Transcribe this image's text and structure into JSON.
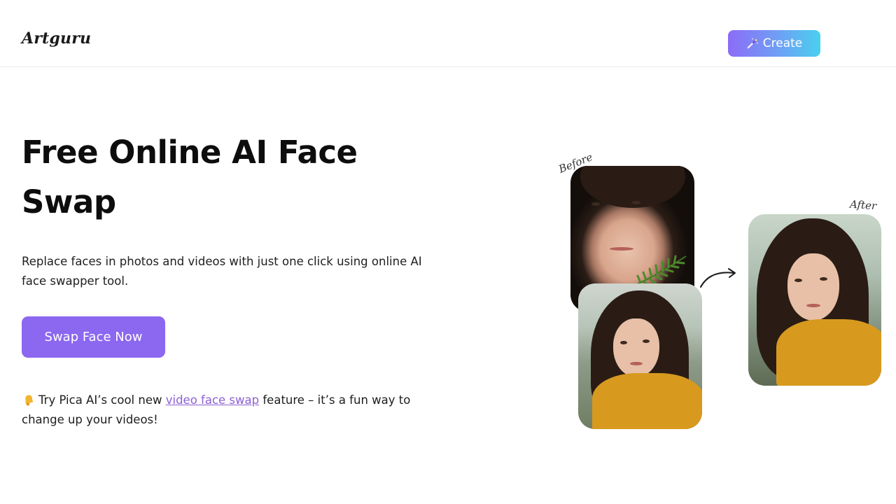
{
  "header": {
    "logo": "Artguru",
    "create_label": "Create",
    "create_icon": "magic-wand-icon"
  },
  "hero": {
    "title": "Free Online AI Face Swap",
    "description": "Replace faces in photos and videos with just one click using online AI face swapper tool.",
    "cta_label": "Swap Face Now",
    "promo": {
      "icon": "bell-icon",
      "prefix": "Try Pica AI’s cool new ",
      "link_text": "video face swap",
      "suffix": " feature – it’s a fun way to change up your videos!"
    }
  },
  "illustration": {
    "before_label": "Before",
    "after_label": "After"
  },
  "colors": {
    "accent": "#8c67f0",
    "gradient_start": "#8b6cf6",
    "gradient_end": "#49d0ee",
    "link": "#8d5fd3"
  }
}
